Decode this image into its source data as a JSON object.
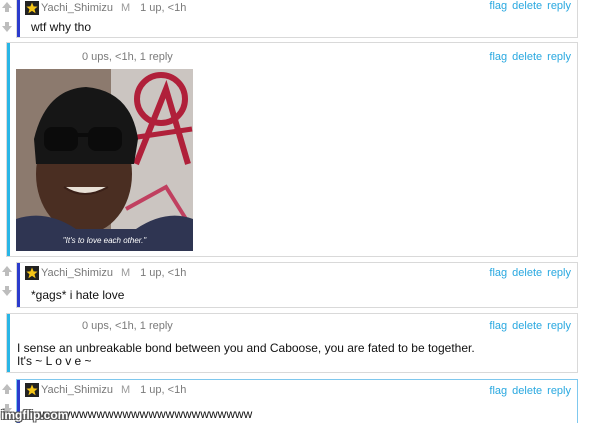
{
  "actions": {
    "flag": "flag",
    "delete": "delete",
    "reply": "reply"
  },
  "comments": [
    {
      "user": "Yachi_Shimizu",
      "mod": "M",
      "meta": "1 up, <1h",
      "text": "wtf why tho"
    },
    {
      "meta": "0 ups, <1h, 1 reply",
      "image_caption": "\"It's to love each other.\""
    },
    {
      "user": "Yachi_Shimizu",
      "mod": "M",
      "meta": "1 up, <1h",
      "text": "*gags* i hate love"
    },
    {
      "meta": "0 ups, <1h, 1 reply",
      "text_line1": "I sense an unbreakable bond between you and Caboose, you are fated to be together.",
      "text_line2": "It's ~ L o v e ~"
    },
    {
      "user": "Yachi_Shimizu",
      "mod": "M",
      "meta": "1 up, <1h",
      "text": "awwwwwwwwwwwwwwwwwwwwwwwww"
    }
  ],
  "watermark": "imgflip.com",
  "colors": {
    "accent_blue": "#2b3bcc",
    "accent_cyan": "#29b6e6",
    "link": "#29a8e0"
  }
}
